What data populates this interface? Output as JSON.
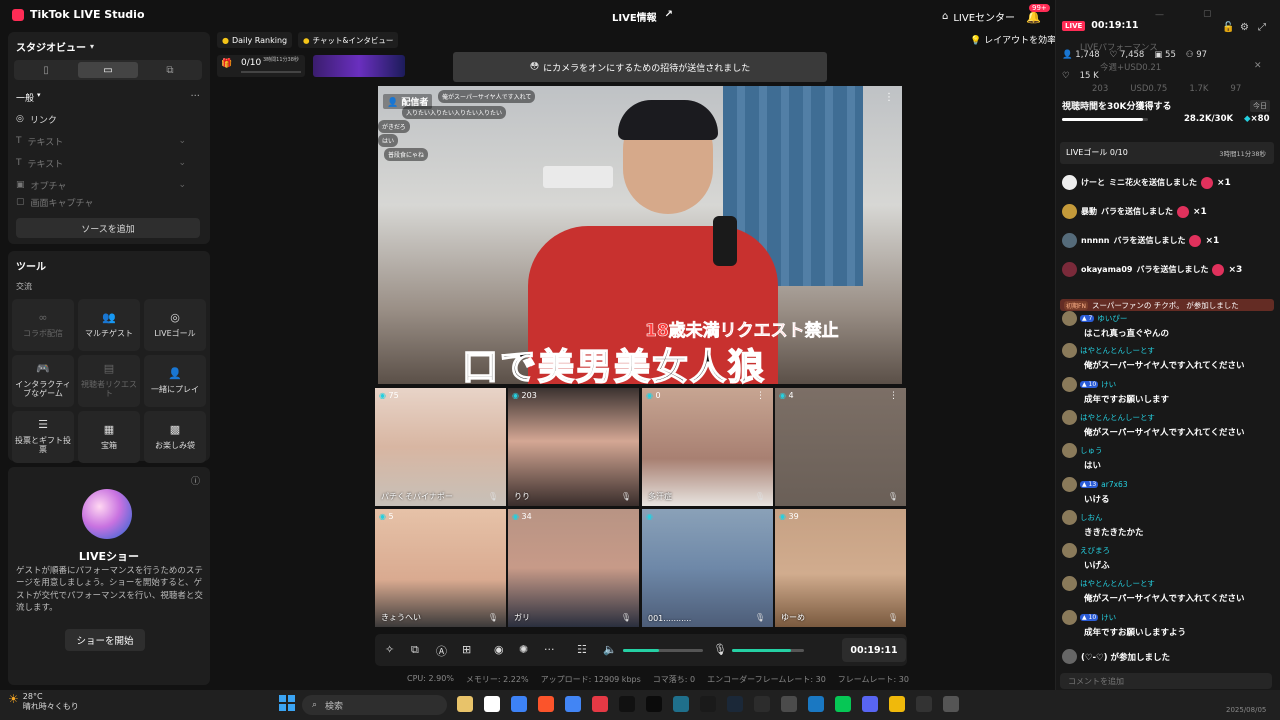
{
  "titlebar": {
    "app_name": "TikTok LIVE Studio",
    "live_info": "LIVE情報",
    "live_center": "LIVEセンター",
    "bell_badge": "99+"
  },
  "studio_view": {
    "title": "スタジオビュー",
    "section_general": "一般",
    "sources": [
      "リンク",
      "テキスト",
      "テキスト",
      "オプチャ",
      "画面キャプチャ"
    ],
    "add_source": "ソースを追加"
  },
  "tools": {
    "title": "ツール",
    "subtitle": "交流",
    "items": [
      "コラボ配信",
      "マルチゲスト",
      "LIVEゴール",
      "インタラクティブなゲーム",
      "視聴者リクエスト",
      "一緒にプレイ",
      "投票とギフト投票",
      "宝箱",
      "お楽しみ袋"
    ]
  },
  "live_show": {
    "title": "LIVEショー",
    "description": "ゲストが順番にパフォーマンスを行うためのステージを用意しましょう。ショーを開始すると、ゲストが交代でパフォーマンスを行い、視聴者と交流します。",
    "button": "ショーを開始"
  },
  "top_strip": {
    "daily_ranking": "Daily Ranking",
    "chat_interview": "チャット&インタビュー",
    "goal": "0/10",
    "goal_time": "3時間11分38秒",
    "notice": "にカメラをオンにするための招待が送信されました",
    "layout_tip": "レイアウトを効率"
  },
  "stage": {
    "host_tag": "配信者",
    "overlay_msgs": [
      "俺がスーパーサイヤ人です入れて",
      "入りたい入りたい入りたい入りたい",
      "がきだろ",
      "はい",
      "普段食にゃね"
    ],
    "age_banner": "18歳未満リクエスト禁止",
    "big_title": "口で美男美女人狼",
    "guests": [
      {
        "count": "75",
        "name": "パチくそパイナポー"
      },
      {
        "count": "203",
        "name": "りり"
      },
      {
        "count": "0",
        "name": "多汗症"
      },
      {
        "count": "4",
        "name": ""
      },
      {
        "count": "5",
        "name": "きょうへい"
      },
      {
        "count": "34",
        "name": "ガリ"
      },
      {
        "count": "",
        "name": "001..........."
      },
      {
        "count": "39",
        "name": "ゆーめ"
      }
    ]
  },
  "controls": {
    "timer": "00:19:11",
    "volume_level": 0.45,
    "mic_level": 0.82
  },
  "stats": [
    "CPU: 2.90%",
    "メモリー: 2.22%",
    "アップロード: 12909 kbps",
    "コマ落ち: 0",
    "エンコーダーフレームレート: 30",
    "フレームレート: 30"
  ],
  "right_panel": {
    "live_badge": "LIVE",
    "timer": "00:19:11",
    "viewers": "1,748",
    "likes": "7,458",
    "gifters": "55",
    "shares": "97",
    "followers": "15 K",
    "faint_perf": "LIVEパフォーマンス",
    "faint_earn": "今週+USD0.21",
    "faint_stats": [
      "203",
      "USD0.75",
      "1.7K",
      "97"
    ],
    "goal_title": "視聴時間を30K分獲得する",
    "goal_today": "今日",
    "goal_value": "28.2K/30K",
    "goal_reward": "×80",
    "goal_fill": 0.94,
    "live_goal": "LIVEゴール 0/10",
    "live_goal_time": "3時間11分38秒",
    "gifts": [
      {
        "user": "けーと",
        "text": "ミニ花火を送信しました",
        "qty": "×1"
      },
      {
        "user": "暴動",
        "text": "バラを送信しました",
        "qty": "×1"
      },
      {
        "user": "nnnnn",
        "text": "バラを送信しました",
        "qty": "×1"
      },
      {
        "user": "okayama09",
        "text": "バラを送信しました",
        "qty": "×3"
      }
    ],
    "superfan": "スーパーファンの チクポ。 が参加しました",
    "superfan_tag": "初期FN",
    "chats": [
      {
        "level": "7",
        "user": "ゆいぴー",
        "msg": "はこれ真っ直ぐやんの"
      },
      {
        "level": "",
        "user": "はやとんとんしーとす",
        "msg": "俺がスーパーサイヤ人です入れてください"
      },
      {
        "level": "10",
        "user": "けい",
        "msg": "成年ですお願いします"
      },
      {
        "level": "",
        "user": "はやとんとんしーとす",
        "msg": "俺がスーパーサイヤ人です入れてください"
      },
      {
        "level": "",
        "user": "しゅう",
        "msg": "はい"
      },
      {
        "level": "13",
        "user": "ar7x63",
        "msg": "いける"
      },
      {
        "level": "",
        "user": "しおん",
        "msg": "ききたきたかた"
      },
      {
        "level": "",
        "user": "えびまろ",
        "msg": "いげふ"
      },
      {
        "level": "",
        "user": "はやとんとんしーとす",
        "msg": "俺がスーパーサイヤ人です入れてください"
      },
      {
        "level": "10",
        "user": "けい",
        "msg": "成年ですお願いしますよう"
      }
    ],
    "joined": "(♡-♡) が参加しました",
    "comment_placeholder": "コメントを追加"
  },
  "taskbar": {
    "temp": "28°C",
    "weather": "晴れ時々くもり",
    "search": "検索",
    "date": "2025/08/05"
  }
}
